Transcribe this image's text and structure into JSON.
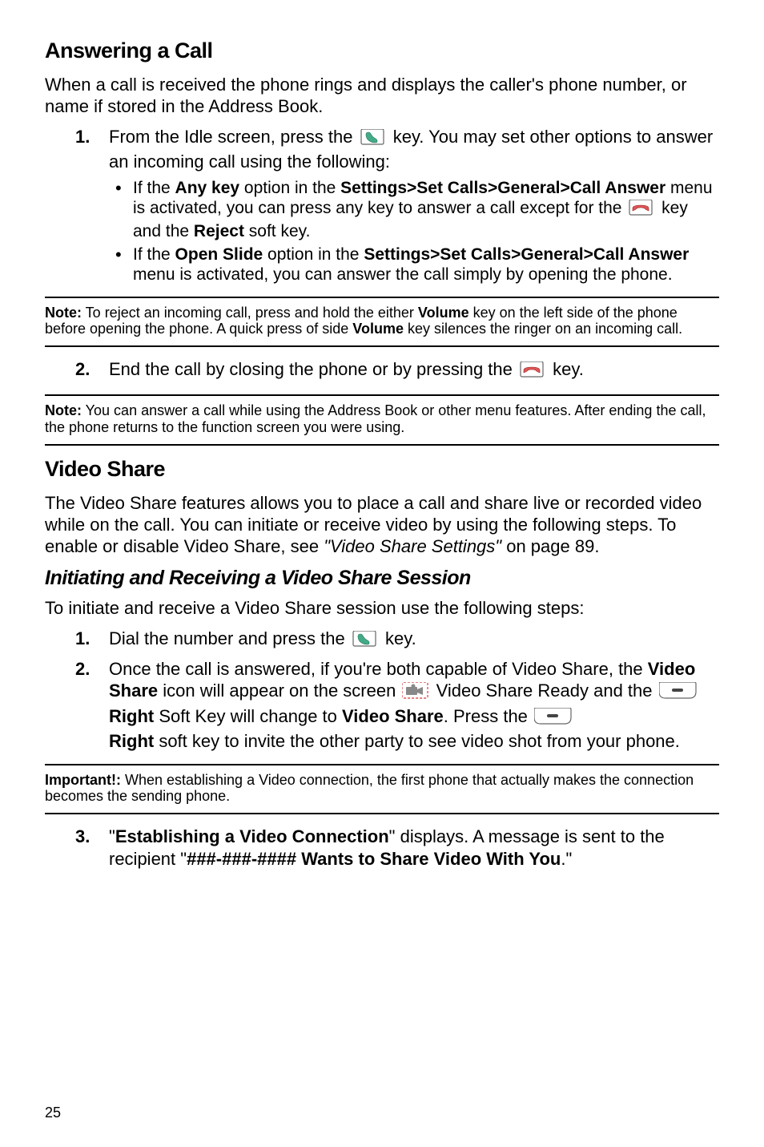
{
  "section1": {
    "heading": "Answering a Call",
    "intro": "When a call is received the phone rings and displays the caller's phone number, or name if stored in the Address Book.",
    "step1_a": "From the Idle screen, press the ",
    "step1_b": " key.  You may set other options to answer an incoming call using the following:",
    "bullet1_a": "If the ",
    "bullet1_b": "Any key",
    "bullet1_c": " option in the ",
    "bullet1_d": "Settings>Set Calls>General>Call Answer",
    "bullet1_e": " menu is activated, you can press any key to answer a call except for the ",
    "bullet1_f": " key and the ",
    "bullet1_g": "Reject",
    "bullet1_h": " soft key.",
    "bullet2_a": "If the ",
    "bullet2_b": "Open Slide",
    "bullet2_c": " option in the ",
    "bullet2_d": "Settings>Set Calls>General>Call Answer",
    "bullet2_e": " menu is activated, you can answer the call simply by opening the phone.",
    "note1_label": "Note:",
    "note1_a": " To reject an incoming call, press and hold the either ",
    "note1_b": "Volume",
    "note1_c": " key on the left side of the phone before opening the phone. A quick press of side ",
    "note1_d": "Volume",
    "note1_e": " key silences the ringer on an incoming call.",
    "step2_a": "End the call by closing the phone or by pressing the ",
    "step2_b": " key.",
    "note2_label": "Note:",
    "note2_a": " You can answer a call while using the Address Book or other menu features. After ending the call, the phone returns to the function screen you were using."
  },
  "section2": {
    "heading": "Video Share",
    "intro_a": "The Video Share features allows you to place a call and share live or recorded video while on the call.  You can initiate or receive video by using the following steps.  To enable or disable Video Share, see ",
    "intro_b": "\"Video Share Settings\"",
    "intro_c": "  on page 89.",
    "sub_heading": "Initiating and Receiving a Video Share Session",
    "sub_intro": "To initiate and receive a Video Share session use the following steps:",
    "step1_a": "Dial the number and press the ",
    "step1_b": " key.",
    "step2_a": "Once the call is answered, if you're both capable of Video Share, the ",
    "step2_b": "Video Share",
    "step2_c": " icon will appear on the screen  ",
    "step2_vsr": "Video Share Ready",
    "step2_d": " and the ",
    "step2_e": "Right",
    "step2_f": " Soft Key will change to ",
    "step2_g": "Video Share",
    "step2_h": ".   Press the ",
    "step2_i": "Right",
    "step2_j": " soft key to invite the other party to see video shot from your phone.",
    "imp_label": "Important!:",
    "imp_a": " When establishing a Video connection, the first phone that actually makes the connection becomes the sending phone.",
    "step3_a": "\"",
    "step3_b": "Establishing a Video Connection",
    "step3_c": "\" displays.  A message is sent to the recipient \"",
    "step3_d": "###-###-#### Wants to Share Video With You",
    "step3_e": ".\""
  },
  "page": "25"
}
